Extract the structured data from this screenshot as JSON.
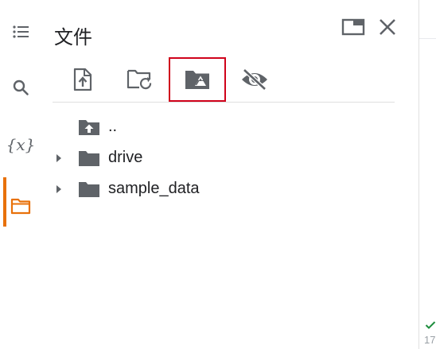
{
  "panel": {
    "title": "文件"
  },
  "rail": {
    "items": [
      {
        "name": "toc",
        "icon": "list-icon"
      },
      {
        "name": "search",
        "icon": "search-icon"
      },
      {
        "name": "variables",
        "label": "{x}"
      },
      {
        "name": "files",
        "icon": "folder-icon",
        "active": true
      }
    ]
  },
  "toolbar": {
    "buttons": [
      {
        "icon": "upload-file-icon"
      },
      {
        "icon": "refresh-folder-icon"
      },
      {
        "icon": "mount-drive-icon",
        "highlighted": true
      },
      {
        "icon": "hide-hidden-files-icon"
      }
    ]
  },
  "tree": {
    "items": [
      {
        "label": "..",
        "icon": "parent-folder-icon",
        "expandable": false
      },
      {
        "label": "drive",
        "icon": "folder-icon",
        "expandable": true
      },
      {
        "label": "sample_data",
        "icon": "folder-icon",
        "expandable": true
      }
    ]
  },
  "status": {
    "count": "17"
  },
  "colors": {
    "accent": "#e8710a",
    "highlight": "#d0021b",
    "icon": "#5f6368",
    "text": "#202124"
  }
}
